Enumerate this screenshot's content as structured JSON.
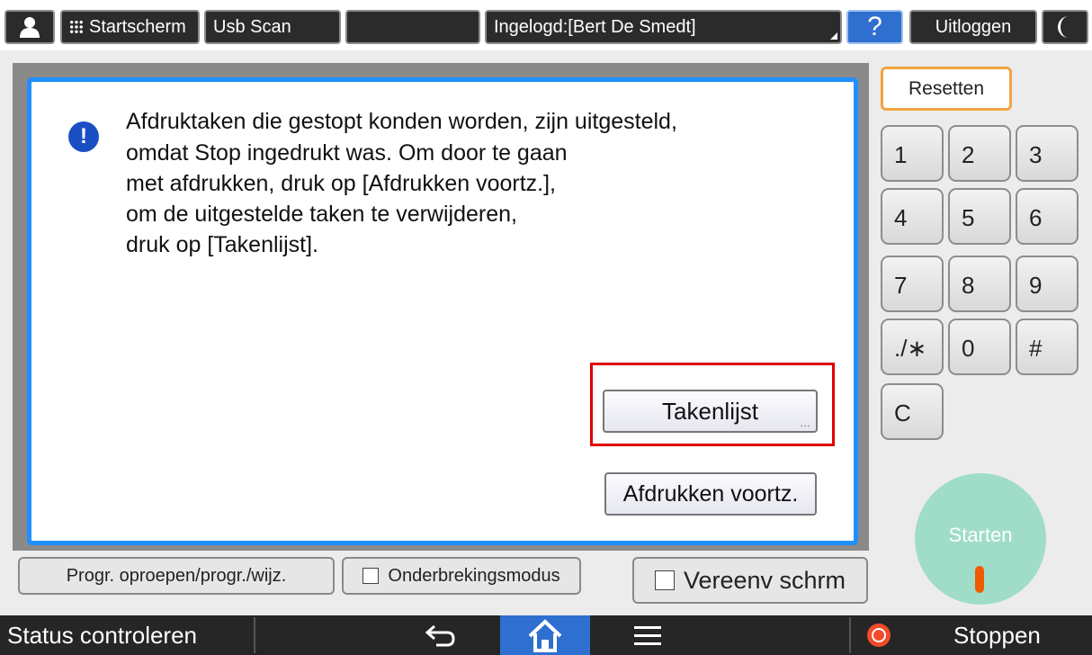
{
  "top": {
    "home_label": "Startscherm",
    "usb_label": "Usb Scan",
    "login_label": "Ingelogd:[Bert De Smedt]",
    "help_label": "?",
    "logout_label": "Uitloggen"
  },
  "dialog": {
    "message_lines": [
      "Afdruktaken die gestopt konden worden, zijn uitgesteld,",
      "omdat Stop ingedrukt was. Om door te gaan",
      "met afdrukken, druk op [Afdrukken voortz.],",
      "om de uitgestelde taken te verwijderen,",
      "druk op [Takenlijst]."
    ],
    "joblist_label": "Takenlijst",
    "resume_label": "Afdrukken voortz."
  },
  "panel_bottom": {
    "program_label": "Progr. oproepen/progr./wijz.",
    "interrupt_label": "Onderbrekingsmodus",
    "simplified_label": "Vereenv schrm"
  },
  "keypad": {
    "reset_label": "Resetten",
    "keys": [
      "1",
      "2",
      "3",
      "4",
      "5",
      "6",
      "7",
      "8",
      "9",
      "./∗",
      "0",
      "#",
      "C"
    ],
    "start_label": "Starten"
  },
  "statusbar": {
    "check_status_label": "Status controleren",
    "stop_label": "Stoppen"
  },
  "colors": {
    "dialog_border": "#1e90ff",
    "highlight": "#e00000",
    "start_button": "#9fddc8",
    "home_active": "#2f6fd0"
  }
}
